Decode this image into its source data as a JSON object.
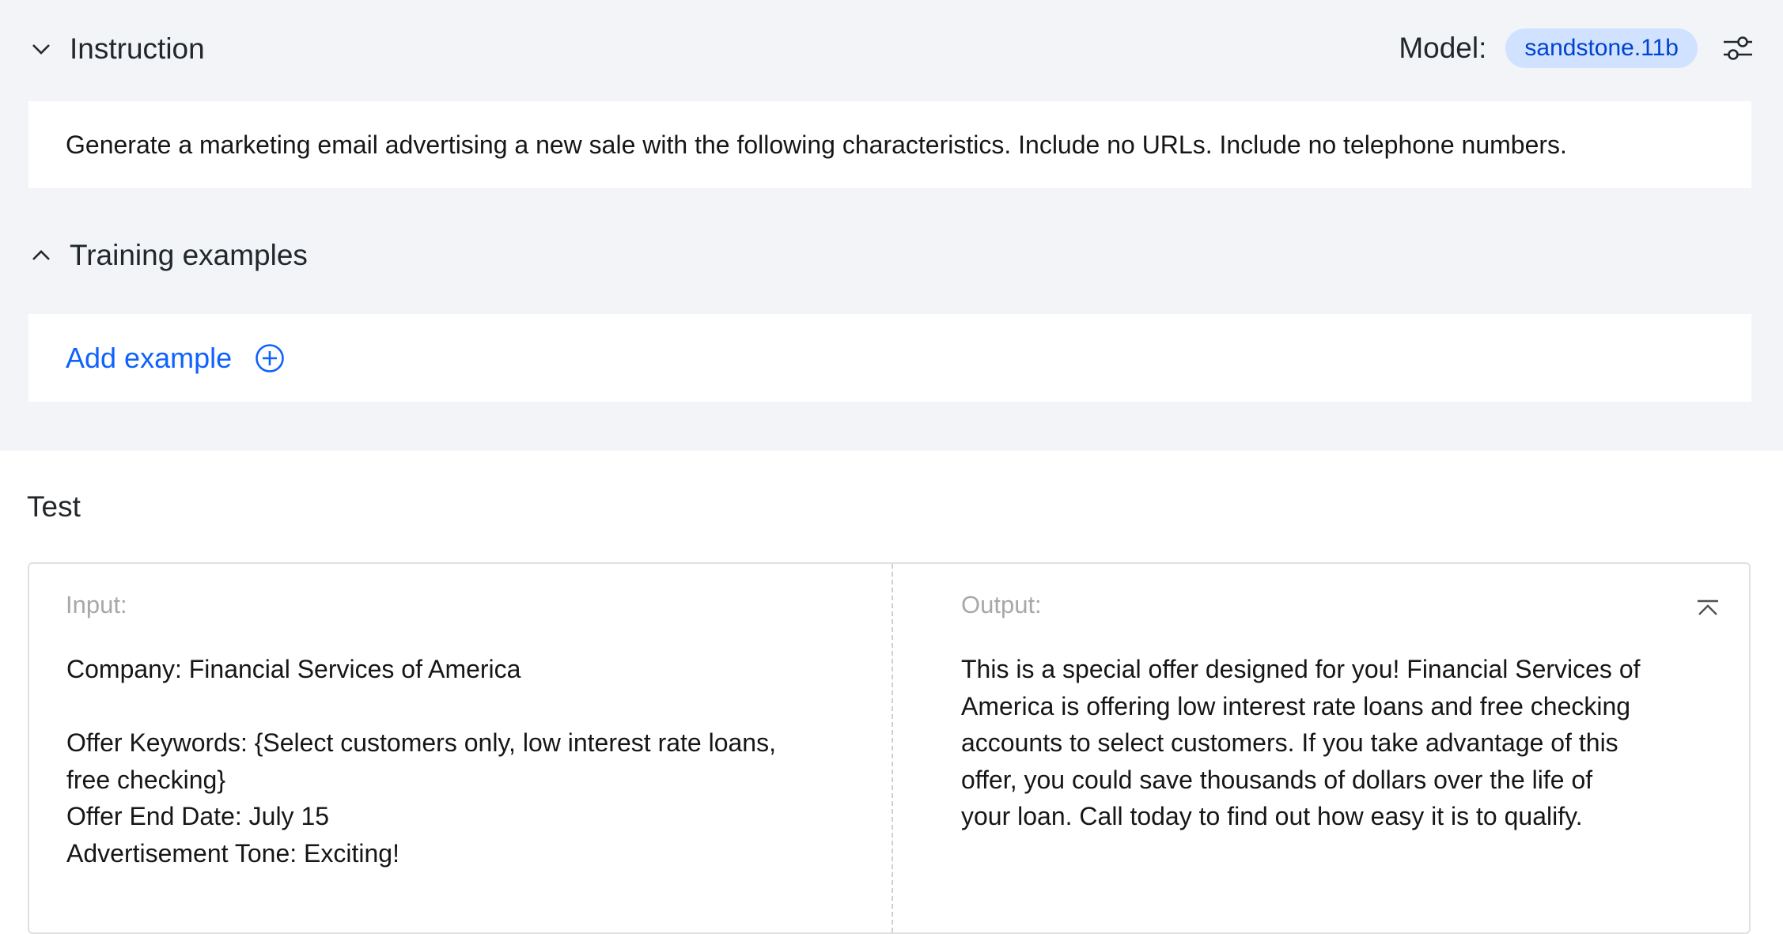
{
  "instruction": {
    "title": "Instruction",
    "text": "Generate a marketing email advertising a new sale with the following characteristics. Include no URLs. Include no telephone numbers.",
    "expanded": true
  },
  "model": {
    "label": "Model:",
    "name": "sandstone.11b"
  },
  "training_examples": {
    "title": "Training examples",
    "add_label": "Add example"
  },
  "test": {
    "title": "Test",
    "input": {
      "label": "Input:",
      "lines": [
        "Company: Financial Services of America",
        "",
        "Offer Keywords: {Select customers only, low interest rate loans,",
        "free checking}",
        "Offer End Date: July 15",
        "Advertisement Tone: Exciting!"
      ]
    },
    "output": {
      "label": "Output:",
      "lines": [
        "This is a special offer designed for you! Financial Services of",
        "America is offering low interest rate loans and free checking",
        "accounts to select customers. If you take advantage of this",
        "offer, you could save thousands of dollars over the life of",
        "your loan. Call today to find out how easy it is to qualify."
      ]
    }
  },
  "icons": {
    "instruction_toggle": "chevron-down-icon",
    "examples_toggle": "chevron-up-icon",
    "settings": "sliders-icon",
    "add": "add-circle-icon",
    "collapse": "collapse-up-icon"
  },
  "colors": {
    "accent": "#0f62fe",
    "tag_bg": "#d0e2ff",
    "tag_text": "#0043ce",
    "top_bg": "#f2f4f8"
  }
}
